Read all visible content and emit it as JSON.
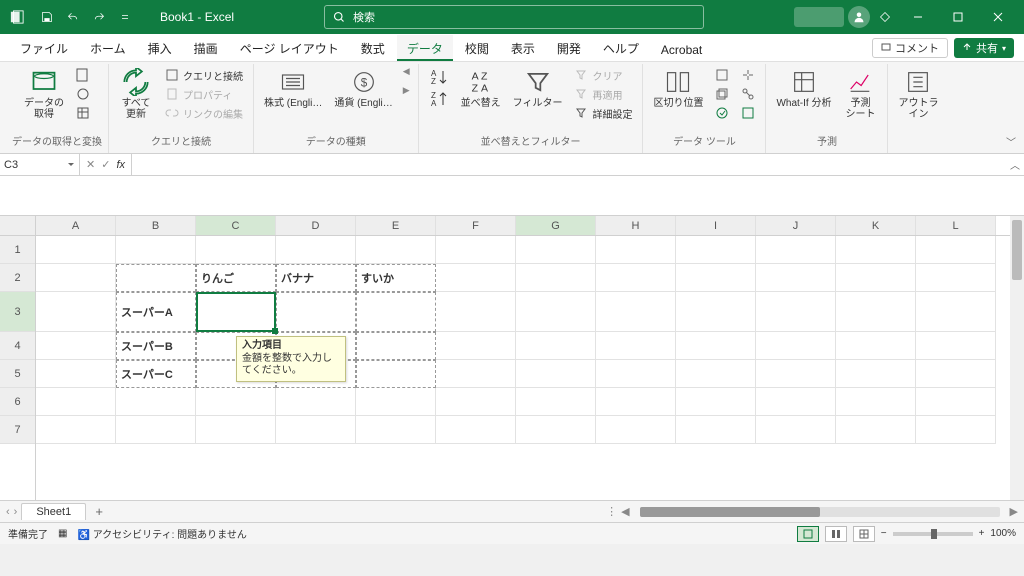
{
  "title": "Book1 - Excel",
  "search_placeholder": "検索",
  "tabs": [
    "ファイル",
    "ホーム",
    "挿入",
    "描画",
    "ページ レイアウト",
    "数式",
    "データ",
    "校閲",
    "表示",
    "開発",
    "ヘルプ",
    "Acrobat"
  ],
  "active_tab": "データ",
  "comment_label": "コメント",
  "share_label": "共有",
  "ribbon": {
    "g1": {
      "big": "データの\n取得",
      "label": "データの取得と変換"
    },
    "g2": {
      "big": "すべて\n更新",
      "items": [
        "クエリと接続",
        "プロパティ",
        "リンクの編集"
      ],
      "label": "クエリと接続"
    },
    "g3": {
      "btns": [
        "株式 (Engli…",
        "通貨 (Engli…"
      ],
      "label": "データの種類"
    },
    "g4": {
      "sort": "並べ替え",
      "filter": "フィルター",
      "clear": "クリア",
      "re": "再適用",
      "adv": "詳細設定",
      "label": "並べ替えとフィルター"
    },
    "g5": {
      "big": "区切り位置",
      "label": "データ ツール"
    },
    "g6": {
      "whatif": "What-If 分析",
      "forecast": "予測\nシート",
      "label": "予測"
    },
    "g7": {
      "big": "アウトラ\nイン",
      "label": ""
    }
  },
  "namebox": "C3",
  "columns": [
    "A",
    "B",
    "C",
    "D",
    "E",
    "F",
    "G",
    "H",
    "I",
    "J",
    "K",
    "L"
  ],
  "rows": [
    "1",
    "2",
    "3",
    "4",
    "5",
    "6",
    "7"
  ],
  "cells": {
    "C2": "りんご",
    "D2": "バナナ",
    "E2": "すいか",
    "B3": "スーパーA",
    "B4": "スーパーB",
    "B5": "スーパーC"
  },
  "tooltip": {
    "title": "入力項目",
    "body": "金額を整数で入力してください。"
  },
  "sheet": "Sheet1",
  "status_ready": "準備完了",
  "status_acc": "アクセシビリティ: 問題ありません",
  "zoom": "100%"
}
